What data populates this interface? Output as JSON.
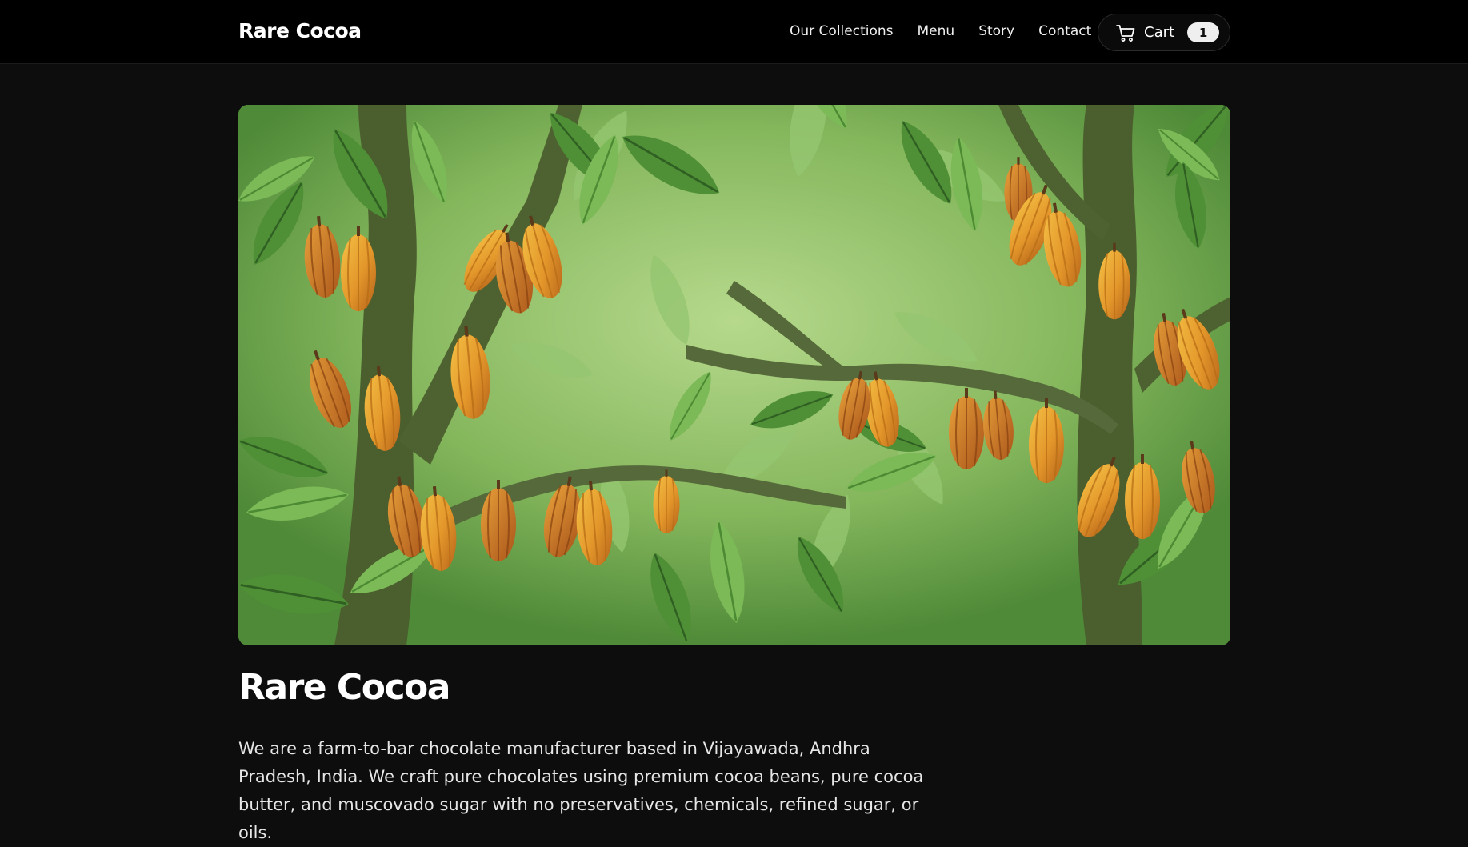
{
  "header": {
    "brand": "Rare Cocoa",
    "nav": [
      {
        "label": "Our Collections"
      },
      {
        "label": "Menu"
      },
      {
        "label": "Story"
      },
      {
        "label": "Contact"
      }
    ],
    "cart": {
      "label": "Cart",
      "count": "1",
      "icon": "cart-icon"
    }
  },
  "hero": {
    "image": "cocoa-tree-illustration"
  },
  "main": {
    "title": "Rare Cocoa",
    "intro": "We are a farm-to-bar chocolate manufacturer based in Vijayawada, Andhra Pradesh, India. We craft pure chocolates using premium cocoa beans, pure cocoa butter, and muscovado sugar with no preservatives, chemicals, refined sugar, or oils."
  },
  "colors": {
    "background": "#0d0d0d",
    "header": "#000000",
    "pod": "#e0a030",
    "leaf": "#4e8a36"
  }
}
